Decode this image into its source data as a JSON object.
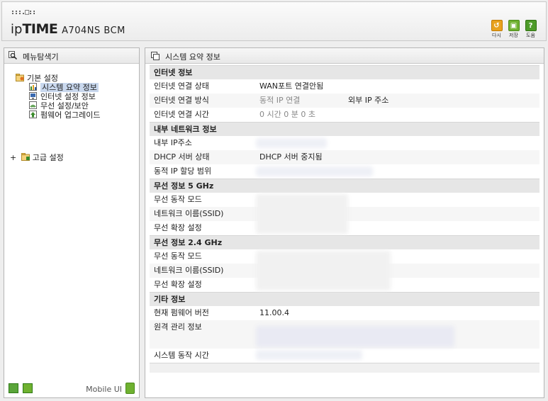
{
  "header": {
    "logo_mark": ":::.□::",
    "brand_ip": "ip",
    "brand_time": "TIME",
    "model": "A704NS BCM",
    "buttons": [
      {
        "icon": "redo-icon",
        "label": "다시"
      },
      {
        "icon": "save-icon",
        "label": "저장"
      },
      {
        "icon": "help-icon",
        "label": "도움"
      }
    ]
  },
  "sidebar": {
    "title": "메뉴탐색기",
    "tree": {
      "basic": "기본 설정",
      "items": [
        "시스템 요약 정보",
        "인터넷 설정 정보",
        "무선 설정/보안",
        "펌웨어 업그레이드"
      ],
      "advanced": "고급 설정",
      "advanced_toggle": "+"
    },
    "mobile_label": "Mobile UI"
  },
  "main": {
    "title": "시스템 요약 정보",
    "sections": {
      "internet": {
        "title": "인터넷 정보",
        "rows": [
          {
            "k": "인터넷 연결 상태",
            "v": "WAN포트 연결안됨"
          },
          {
            "k": "인터넷 연결 방식",
            "v": "동적 IP 연결",
            "v2": "외부 IP 주소"
          },
          {
            "k": "인터넷 연결 시간",
            "v": "0 시간 0 분 0 초"
          }
        ]
      },
      "lan": {
        "title": "내부 네트워크 정보",
        "rows": [
          {
            "k": "내부 IP주소",
            "v": ""
          },
          {
            "k": "DHCP 서버 상태",
            "v": "DHCP 서버 중지됨"
          },
          {
            "k": "동적 IP 할당 범위",
            "v": ""
          }
        ]
      },
      "wifi5": {
        "title": "무선 정보 5 GHz",
        "rows": [
          {
            "k": "무선 동작 모드",
            "v": ""
          },
          {
            "k": "네트워크 이름(SSID)",
            "v": ""
          },
          {
            "k": "무선 확장 설정",
            "v": ""
          }
        ]
      },
      "wifi24": {
        "title": "무선 정보 2.4 GHz",
        "rows": [
          {
            "k": "무선 동작 모드",
            "v": ""
          },
          {
            "k": "네트워크 이름(SSID)",
            "v": ""
          },
          {
            "k": "무선 확장 설정",
            "v": ""
          }
        ]
      },
      "etc": {
        "title": "기타 정보",
        "rows": [
          {
            "k": "현재 펌웨어 버전",
            "v": "11.00.4"
          },
          {
            "k": "원격 관리 정보",
            "v": ""
          },
          {
            "k": "시스템 동작 시간",
            "v": ""
          }
        ]
      }
    }
  }
}
